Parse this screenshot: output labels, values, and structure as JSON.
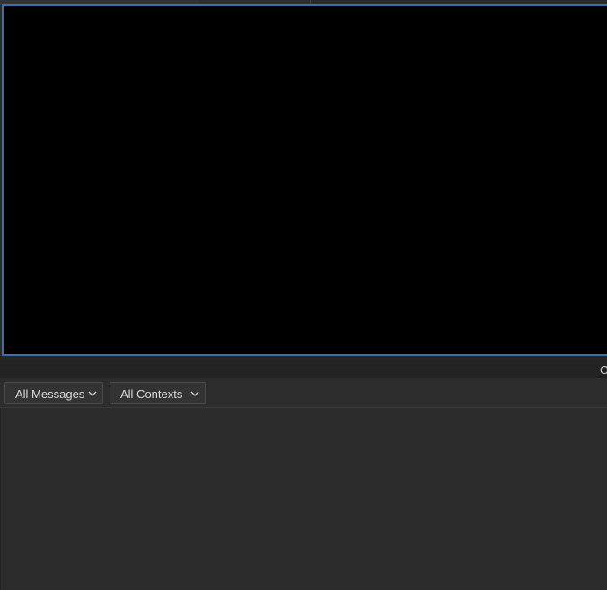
{
  "console": {
    "header_partial_text": "O",
    "filters": {
      "messages": {
        "selected": "All Messages"
      },
      "contexts": {
        "selected": "All Contexts"
      }
    }
  },
  "colors": {
    "viewport_background": "#000000",
    "viewport_border": "#3d6fa6",
    "panel_background": "#2c2c2c"
  }
}
